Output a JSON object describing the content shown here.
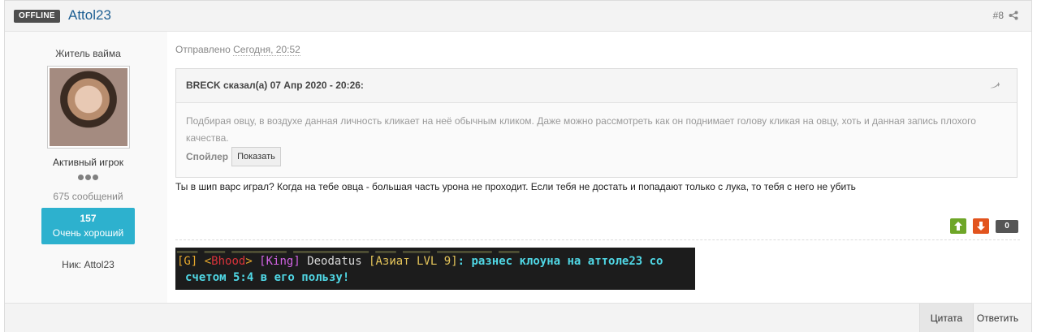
{
  "header": {
    "status_badge": "OFFLINE",
    "author_name": "Attol23",
    "post_number": "#8"
  },
  "author": {
    "title": "Житель вайма",
    "rank": "Активный игрок",
    "posts_count": "675 сообщений",
    "reputation_value": "157",
    "reputation_label": "Очень хороший",
    "nick_label": "Ник: Attol23"
  },
  "post": {
    "posted_label": "Отправлено",
    "posted_date": "Сегодня, 20:52",
    "quote": {
      "header": "BRECK сказал(а) 07 Апр 2020 - 20:26:",
      "body": "Подбирая овцу, в воздухе данная личность кликает на неё обычным кликом. Даже можно рассмотреть как он поднимает голову кликая на овцу, хоть и данная запись плохого качества.",
      "spoiler_label": "Спойлер",
      "spoiler_button": "Показать"
    },
    "text": "Ты в шип варс играл? Когда на тебе овца - большая часть урона не проходит. Если тебя не достать и попадают только с лука, то тебя с него не убить",
    "votes": {
      "score": "0"
    }
  },
  "screenshot_chat": {
    "line1_channel": "[G] ",
    "line1_open": "<",
    "line1_clan": "Bhood",
    "line1_close": "> ",
    "line1_rank": "[King] ",
    "line1_name": "Deodatus ",
    "line1_level": "[Азиат LVL 9]",
    "line1_message": ": разнес клоуна на аттоле23 со",
    "line2_message": "счетом 5:4 в его пользу!"
  },
  "footer": {
    "quote_button": "Цитата",
    "reply_button": "Ответить"
  },
  "colors": {
    "link": "#1e5f93",
    "reputation": "#2db1ce",
    "vote_up": "#6ea628",
    "vote_down": "#e2541e"
  }
}
